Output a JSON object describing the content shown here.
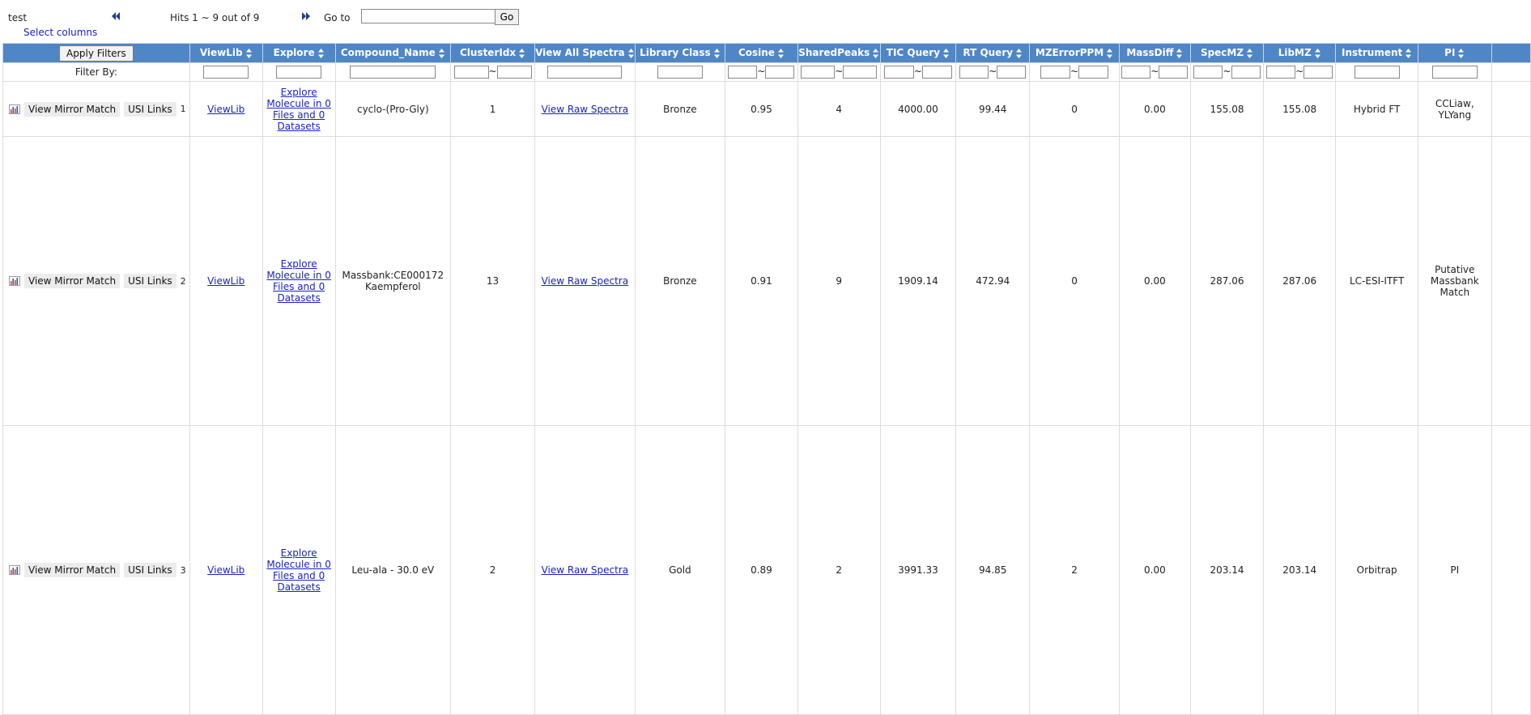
{
  "topbar": {
    "dataset_name": "test",
    "hits_text": "Hits 1 ~ 9 out of 9",
    "goto_label": "Go to",
    "goto_value": "",
    "go_button": "Go",
    "select_columns": "Select columns"
  },
  "table": {
    "apply_filters": "Apply Filters",
    "filter_by": "Filter By:",
    "tilde": "~",
    "columns": [
      "ViewLib",
      "Explore",
      "Compound_Name",
      "ClusterIdx",
      "View All Spectra",
      "Library Class",
      "Cosine",
      "SharedPeaks",
      "TIC Query",
      "RT Query",
      "MZErrorPPM",
      "MassDiff",
      "SpecMZ",
      "LibMZ",
      "Instrument",
      "PI"
    ],
    "action_labels": {
      "mirror": "View Mirror Match",
      "usi": "USI Links"
    },
    "rows": [
      {
        "num": "1",
        "viewlib": "ViewLib",
        "explore": [
          "Explore",
          "Molecule in 0",
          "Files and 0",
          "Datasets"
        ],
        "compound": [
          "cyclo-(Pro-Gly)"
        ],
        "cluster": "1",
        "view_all": "View Raw Spectra",
        "lib_class": "Bronze",
        "cosine": "0.95",
        "shared": "4",
        "tic": "4000.00",
        "rt": "99.44",
        "mzerr": "0",
        "massdiff": "0.00",
        "specmz": "155.08",
        "libmz": "155.08",
        "instrument": "Hybrid FT",
        "pi": [
          "CCLiaw,",
          "YLYang"
        ]
      },
      {
        "num": "2",
        "viewlib": "ViewLib",
        "explore": [
          "Explore",
          "Molecule in 0",
          "Files and 0",
          "Datasets"
        ],
        "compound": [
          "Massbank:CE000172",
          "Kaempferol"
        ],
        "cluster": "13",
        "view_all": "View Raw Spectra",
        "lib_class": "Bronze",
        "cosine": "0.91",
        "shared": "9",
        "tic": "1909.14",
        "rt": "472.94",
        "mzerr": "0",
        "massdiff": "0.00",
        "specmz": "287.06",
        "libmz": "287.06",
        "instrument": "LC-ESI-ITFT",
        "pi": [
          "Putative",
          "Massbank",
          "Match"
        ]
      },
      {
        "num": "3",
        "viewlib": "ViewLib",
        "explore": [
          "Explore",
          "Molecule in 0",
          "Files and 0",
          "Datasets"
        ],
        "compound": [
          "Leu-ala - 30.0 eV"
        ],
        "cluster": "2",
        "view_all": "View Raw Spectra",
        "lib_class": "Gold",
        "cosine": "0.89",
        "shared": "2",
        "tic": "3991.33",
        "rt": "94.85",
        "mzerr": "2",
        "massdiff": "0.00",
        "specmz": "203.14",
        "libmz": "203.14",
        "instrument": "Orbitrap",
        "pi": [
          "PI"
        ]
      }
    ]
  }
}
